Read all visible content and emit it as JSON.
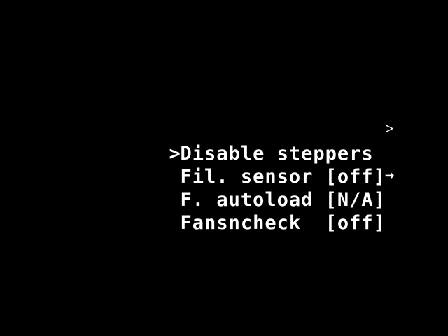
{
  "menu": {
    "items": [
      {
        "cursor": ">",
        "label": "Disable steppers",
        "suffix": "˃"
      },
      {
        "cursor": " ",
        "label": "Fil. sensor [off]",
        "suffix": ""
      },
      {
        "cursor": " ",
        "label": "F. autoload [N/A]",
        "suffix": "→"
      },
      {
        "cursor": " ",
        "label": "Fansncheck  [off]",
        "suffix": ""
      }
    ]
  },
  "colors": {
    "background": "#000000",
    "text": "#ffffff"
  }
}
